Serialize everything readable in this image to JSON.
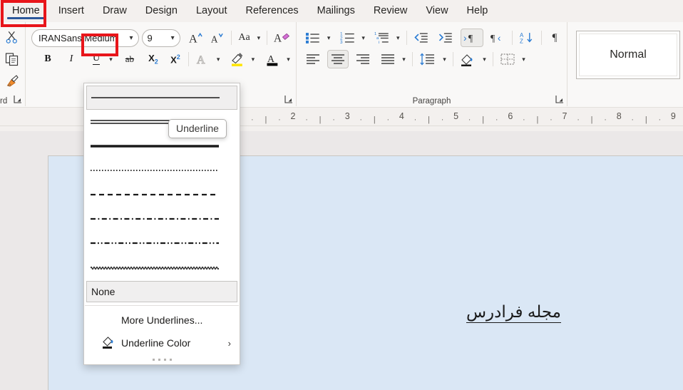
{
  "tabs": [
    {
      "label": "Home",
      "active": true
    },
    {
      "label": "Insert",
      "active": false
    },
    {
      "label": "Draw",
      "active": false
    },
    {
      "label": "Design",
      "active": false
    },
    {
      "label": "Layout",
      "active": false
    },
    {
      "label": "References",
      "active": false
    },
    {
      "label": "Mailings",
      "active": false
    },
    {
      "label": "Review",
      "active": false
    },
    {
      "label": "View",
      "active": false
    },
    {
      "label": "Help",
      "active": false
    }
  ],
  "ribbon": {
    "clipboard": {
      "label": "rd",
      "full_label": "Clipboard",
      "cut": "cut-icon",
      "copy": "copy-icon",
      "format_painter": "format-painter-icon"
    },
    "font": {
      "label": "",
      "font_name": "IRANSans Medium",
      "font_size": "9",
      "grow_font": "A",
      "shrink_font": "A",
      "change_case": "Aa",
      "clear_formatting": "A",
      "bold": "B",
      "italic": "I",
      "underline": "U",
      "strikethrough": "ab",
      "subscript": "X",
      "subscript_sub": "2",
      "superscript": "X",
      "superscript_sup": "2",
      "text_effects": "A",
      "highlight_color": "highlight-icon",
      "font_color": "A"
    },
    "paragraph": {
      "label": "Paragraph",
      "bullets": "bullet-list-icon",
      "numbering": "numbered-list-icon",
      "multilevel": "multilevel-list-icon",
      "decrease_indent": "decrease-indent-icon",
      "increase_indent": "increase-indent-icon",
      "ltr_text": "left-to-right-icon",
      "rtl_text": "right-to-left-icon",
      "sort": "sort-icon",
      "show_marks": "¶",
      "align_left": "align-left-icon",
      "align_center": "align-center-icon",
      "align_right": "align-right-icon",
      "justify": "justify-icon",
      "line_spacing": "line-spacing-icon",
      "shading": "shading-icon",
      "borders": "borders-icon"
    },
    "styles": {
      "normal": "Normal"
    }
  },
  "ruler": {
    "marks": [
      "2",
      "3",
      "4",
      "5",
      "6",
      "7",
      "8",
      "9"
    ]
  },
  "underline_dropdown": {
    "styles": [
      {
        "name": "single-underline",
        "kind": "single",
        "selected": true
      },
      {
        "name": "double-underline",
        "kind": "double",
        "selected": false
      },
      {
        "name": "thick-underline",
        "kind": "thick",
        "selected": false
      },
      {
        "name": "dotted-underline",
        "kind": "dotted",
        "selected": false
      },
      {
        "name": "dashed-underline",
        "kind": "dashed",
        "selected": false
      },
      {
        "name": "dash-dot-underline",
        "kind": "dashdot",
        "selected": false
      },
      {
        "name": "dash-dot-dot-underline",
        "kind": "dashdotdot",
        "selected": false
      },
      {
        "name": "wavy-underline",
        "kind": "wavy",
        "selected": false
      }
    ],
    "none_label": "None",
    "more_underlines_label": "More Underlines...",
    "more_underlines_accel": "M",
    "underline_color_label": "Underline Color",
    "underline_color_accel": "U",
    "submenu_arrow": "›"
  },
  "tooltip": {
    "text": "Underline"
  },
  "document": {
    "text": "مجله فرادرس"
  },
  "colors": {
    "accent": "#2b579a",
    "highlight_box": "#e8151a",
    "selection": "#dae7f5",
    "ribbon_bg": "#f9f8f7"
  }
}
